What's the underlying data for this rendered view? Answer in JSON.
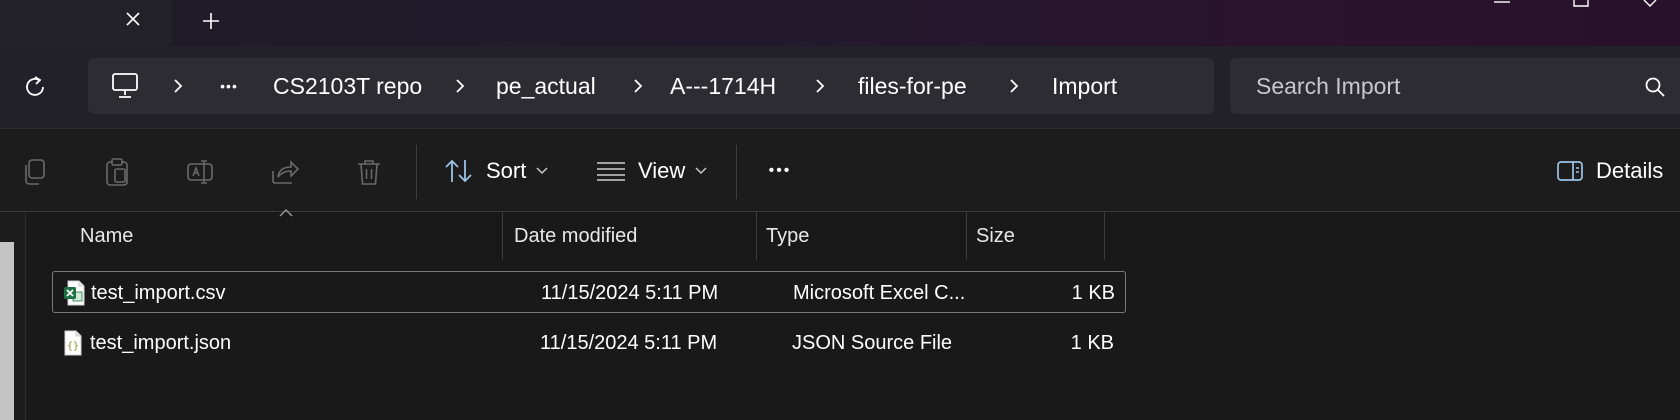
{
  "tabs": {
    "close_icon": "close-icon",
    "new_tab_icon": "plus-icon"
  },
  "window_controls": [
    "minimize-icon",
    "maximize-icon",
    "close-icon"
  ],
  "address": {
    "refresh_icon": "refresh-icon",
    "root_icon": "this-pc-icon",
    "overflow": "•••",
    "breadcrumbs": [
      "CS2103T repo",
      "pe_actual",
      "A---1714H",
      "files-for-pe",
      "Import"
    ]
  },
  "search": {
    "placeholder": "Search Import",
    "icon": "search-icon"
  },
  "toolbar": {
    "icons": [
      "copy-icon",
      "paste-icon",
      "rename-icon",
      "share-icon",
      "delete-icon"
    ],
    "sort_label": "Sort",
    "view_label": "View",
    "more_label": "•••",
    "details_label": "Details"
  },
  "columns": {
    "name": "Name",
    "date": "Date modified",
    "type": "Type",
    "size": "Size"
  },
  "files": [
    {
      "name": "test_import.csv",
      "date": "11/15/2024 5:11 PM",
      "type": "Microsoft Excel C...",
      "size": "1 KB",
      "icon": "excel-csv-icon",
      "selected": true
    },
    {
      "name": "test_import.json",
      "date": "11/15/2024 5:11 PM",
      "type": "JSON Source File",
      "size": "1 KB",
      "icon": "json-file-icon",
      "selected": false
    }
  ],
  "colors": {
    "background": "#191919",
    "breadcrumb_bg": "#2d2c33",
    "excel_green": "#1d7044",
    "accent_blue": "#9cc3e6"
  }
}
